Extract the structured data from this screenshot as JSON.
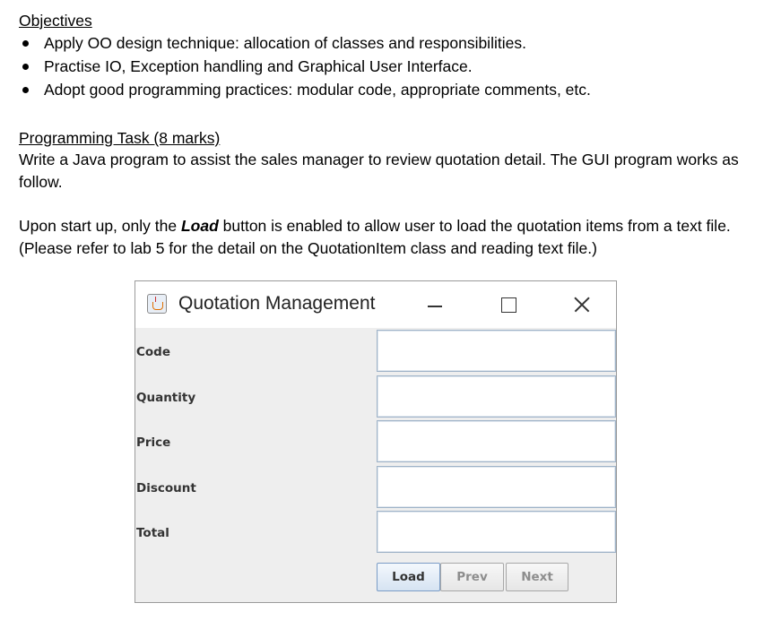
{
  "objectives": {
    "heading": "Objectives",
    "items": [
      "Apply OO design technique: allocation of classes and responsibilities.",
      "Practise IO, Exception handling and Graphical User Interface.",
      "Adopt good programming practices: modular code, appropriate comments, etc."
    ]
  },
  "task": {
    "heading": "Programming Task (8 marks)",
    "intro": "Write a Java program to assist the sales manager to review quotation detail.  The GUI program works as follow.",
    "startup_before": "Upon start up, only the ",
    "startup_emphasis": "Load",
    "startup_after": " button is enabled to allow user to load the quotation items from a text file.  (Please refer to lab 5 for the detail on the QuotationItem class and reading text file.)"
  },
  "window": {
    "title": "Quotation Management",
    "icon": "java-coffee-icon",
    "controls": {
      "minimize_icon": "minimize-icon",
      "maximize_icon": "maximize-icon",
      "close_icon": "close-icon"
    },
    "fields": [
      {
        "label": "Code",
        "value": ""
      },
      {
        "label": "Quantity",
        "value": ""
      },
      {
        "label": "Price",
        "value": ""
      },
      {
        "label": "Discount",
        "value": ""
      },
      {
        "label": "Total",
        "value": ""
      }
    ],
    "buttons": {
      "load": "Load",
      "prev": "Prev",
      "next": "Next"
    }
  }
}
